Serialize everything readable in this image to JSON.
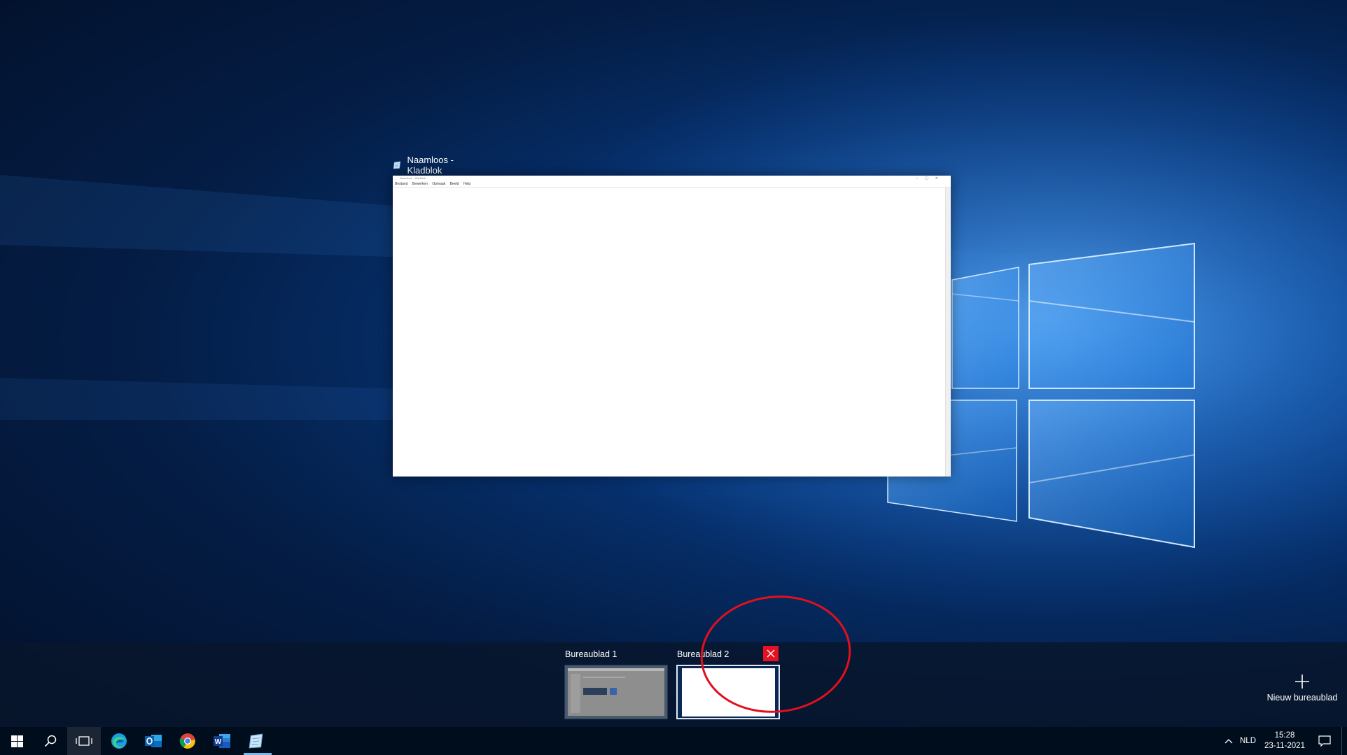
{
  "window": {
    "title": "Naamloos - Kladblok",
    "thumb_title": "Naamloos - Kladblok",
    "menu": [
      "Bestand",
      "Bewerken",
      "Opmaak",
      "Beeld",
      "Help"
    ]
  },
  "virtual_desktops": [
    {
      "label": "Bureaublad 1",
      "active": false
    },
    {
      "label": "Bureaublad 2",
      "active": true
    }
  ],
  "new_desktop": {
    "label": "Nieuw bureaublad"
  },
  "taskbar": {
    "icons": [
      "windows-start-icon",
      "search-icon",
      "task-view-icon",
      "edge-icon",
      "outlook-icon",
      "chrome-icon",
      "word-icon",
      "notepad-icon"
    ]
  },
  "tray": {
    "language": "NLD",
    "time": "15:28",
    "date": "23-11-2021"
  },
  "colors": {
    "close_red": "#e81123",
    "annotation_red": "#e0101e",
    "taskbar": "#000d1c"
  }
}
